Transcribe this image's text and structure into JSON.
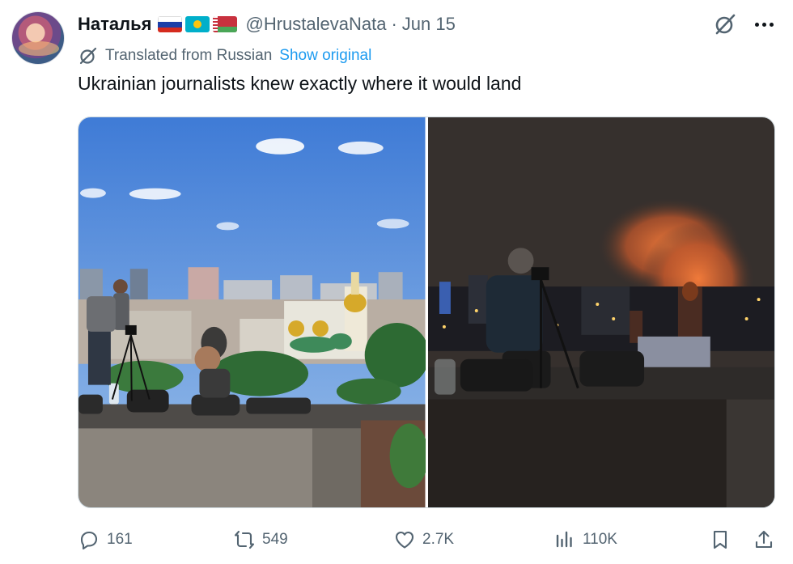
{
  "author": {
    "name": "Наталья",
    "handle": "@HrustalevaNata",
    "separator": "·",
    "date": "Jun 15",
    "flags": [
      "russia-flag",
      "kazakhstan-flag",
      "belarus-flag"
    ]
  },
  "translation": {
    "label": "Translated from Russian",
    "show_original": "Show original"
  },
  "tweet": {
    "text": "Ukrainian journalists knew exactly where it would land"
  },
  "media": {
    "photos": [
      "daytime-photo",
      "nighttime-photo"
    ]
  },
  "actions": {
    "replies": "161",
    "reposts": "549",
    "likes": "2.7K",
    "views": "110K"
  },
  "colors": {
    "link": "#1d9bf0",
    "secondary_text": "#536471",
    "primary_text": "#0f1419"
  }
}
